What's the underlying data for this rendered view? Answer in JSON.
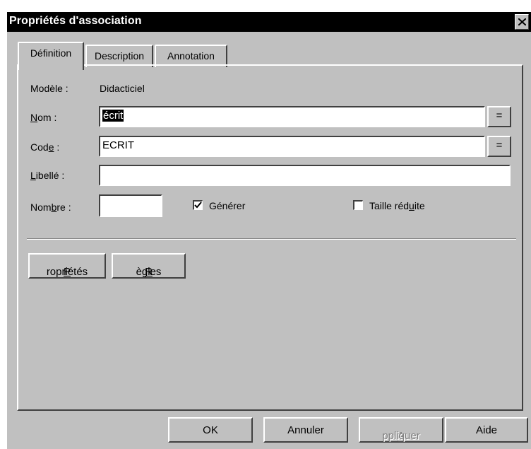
{
  "window": {
    "title": "Propriétés d'association"
  },
  "tabs": [
    {
      "label": "Définition"
    },
    {
      "label": "Description"
    },
    {
      "label": "Annotation"
    }
  ],
  "form": {
    "modele_label": "Modèle :",
    "modele_value": "Didacticiel",
    "nom_label_pre": "",
    "nom_label_key": "N",
    "nom_label_post": "om :",
    "nom_value": "écrit",
    "code_label_pre": "Cod",
    "code_label_key": "e",
    "code_label_post": " :",
    "code_value": "ECRIT",
    "libelle_label_pre": "",
    "libelle_label_key": "L",
    "libelle_label_post": "ibellé :",
    "libelle_value": "",
    "nombre_label_pre": "Nom",
    "nombre_label_key": "b",
    "nombre_label_post": "re :",
    "nombre_value": "",
    "equals_label": "=",
    "generer_label": "Générer",
    "generer_checked": true,
    "taille_label_pre": "Taille réd",
    "taille_label_key": "u",
    "taille_label_post": "ite",
    "taille_checked": false
  },
  "panel_buttons": {
    "proprietes_key": "P",
    "proprietes_rest": "ropriétés",
    "regles_key": "R",
    "regles_rest": "ègles"
  },
  "footer": {
    "ok": "OK",
    "annuler": "Annuler",
    "appliquer_key": "A",
    "appliquer_rest": "ppliquer",
    "aide": "Aide"
  }
}
